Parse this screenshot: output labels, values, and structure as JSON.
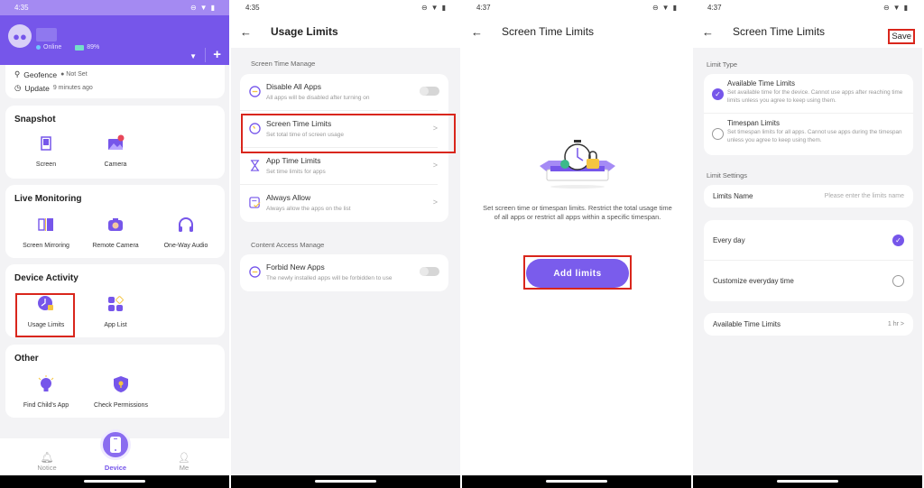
{
  "panel1": {
    "status_time": "4:35",
    "online_label": "Online",
    "battery": "89%",
    "geofence_label": "Geofence",
    "geofence_value": "Not Set",
    "update_label": "Update",
    "update_value": "9 minutes ago",
    "sections": [
      {
        "title": "Snapshot",
        "items": [
          "Screen",
          "Camera"
        ]
      },
      {
        "title": "Live Monitoring",
        "items": [
          "Screen Mirroring",
          "Remote Camera",
          "One-Way Audio"
        ]
      },
      {
        "title": "Device Activity",
        "items": [
          "Usage Limits",
          "App List"
        ]
      },
      {
        "title": "Other",
        "items": [
          "Find Child's App",
          "Check Permissions"
        ]
      }
    ],
    "tabs": [
      "Notice",
      "Device",
      "Me"
    ]
  },
  "panel2": {
    "status_time": "4:35",
    "title": "Usage Limits",
    "section1": "Screen Time Manage",
    "items1": [
      {
        "title": "Disable All Apps",
        "subtitle": "All apps will be disabled after turning on"
      },
      {
        "title": "Screen Time Limits",
        "subtitle": "Set total time of screen usage"
      },
      {
        "title": "App Time Limits",
        "subtitle": "Set time limits for apps"
      },
      {
        "title": "Always Allow",
        "subtitle": "Always allow the apps on the list"
      }
    ],
    "section2": "Content Access Manage",
    "items2": [
      {
        "title": "Forbid New Apps",
        "subtitle": "The newly installed apps will be forbidden to use"
      }
    ]
  },
  "panel3": {
    "status_time": "4:37",
    "title": "Screen Time Limits",
    "description": "Set screen time or timespan limits. Restrict the total usage time of all apps or restrict all apps within a specific timespan.",
    "button": "Add limits"
  },
  "panel4": {
    "status_time": "4:37",
    "title": "Screen Time Limits",
    "save": "Save",
    "limit_type_label": "Limit Type",
    "options": [
      {
        "title": "Available Time Limits",
        "subtitle": "Set available time for the device. Cannot use apps after reaching time limits unless you agree to keep using them.",
        "selected": true
      },
      {
        "title": "Timespan Limits",
        "subtitle": "Set timespan limits for all apps. Cannot use apps during the timespan unless you agree to keep using them.",
        "selected": false
      }
    ],
    "limit_settings_label": "Limit Settings",
    "limits_name_label": "Limits Name",
    "limits_name_placeholder": "Please enter the limits name",
    "every_day": "Every day",
    "customize": "Customize everyday time",
    "available_time_label": "Available Time Limits",
    "available_time_value": "1 hr"
  },
  "colors": {
    "accent": "#7656ea",
    "highlight": "#d9261c"
  }
}
